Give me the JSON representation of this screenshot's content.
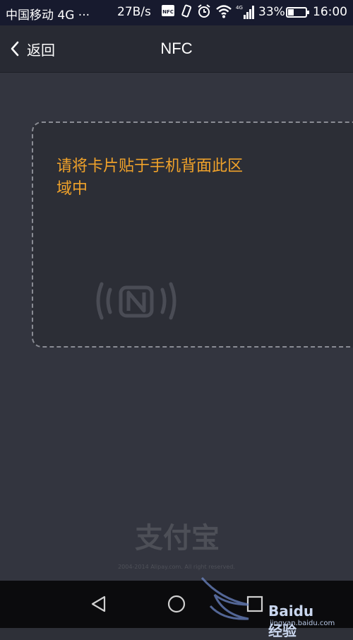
{
  "status_bar": {
    "carrier": "中国移动 4G ···",
    "speed": "27B/s",
    "nfc_badge": "NFC",
    "battery": "33%",
    "battery_level": 0.33,
    "time": "16:00"
  },
  "nav": {
    "back_label": "返回",
    "title": "NFC"
  },
  "card": {
    "instruction": "请将卡片贴于手机背面此区域中",
    "icon": "nfc-icon"
  },
  "footer": {
    "brand": "支付宝",
    "copyright": "2004-2014 Alipay.com. All right reserved."
  },
  "system_nav": {
    "back_icon": "triangle-back-icon",
    "home_icon": "circle-home-icon",
    "recents_icon": "square-recents-icon"
  },
  "watermark": {
    "text": "Baidu 经验",
    "url": "jingyan.baidu.com"
  },
  "colors": {
    "accent": "#f0a22a",
    "status_bar": "#171a2e",
    "background": "#33353f"
  }
}
